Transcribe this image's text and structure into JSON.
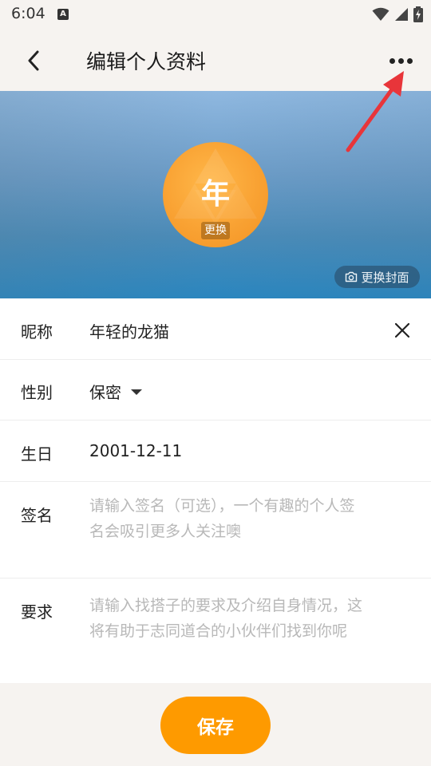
{
  "status_bar": {
    "time": "6:04",
    "notification_letter": "A"
  },
  "header": {
    "title": "编辑个人资料"
  },
  "cover": {
    "avatar_text": "年",
    "avatar_change_label": "更换",
    "change_cover_label": "更换封面"
  },
  "form": {
    "nickname": {
      "label": "昵称",
      "value": "年轻的龙猫"
    },
    "gender": {
      "label": "性别",
      "value": "保密"
    },
    "birthday": {
      "label": "生日",
      "value": "2001-12-11"
    },
    "signature": {
      "label": "签名",
      "placeholder": "请输入签名（可选），一个有趣的个人签名会吸引更多人关注噢"
    },
    "requirement": {
      "label": "要求",
      "placeholder": "请输入找搭子的要求及介绍自身情况，这将有助于志同道合的小伙伴们找到你呢"
    }
  },
  "footer": {
    "save_label": "保存"
  },
  "colors": {
    "accent": "#fe9a00",
    "annotation_arrow": "#e8353a",
    "avatar": "#f9a233"
  },
  "icons": [
    "back-arrow-icon",
    "more-icon",
    "camera-icon",
    "close-icon",
    "dropdown-caret-icon",
    "wifi-icon",
    "signal-icon",
    "battery-icon"
  ]
}
